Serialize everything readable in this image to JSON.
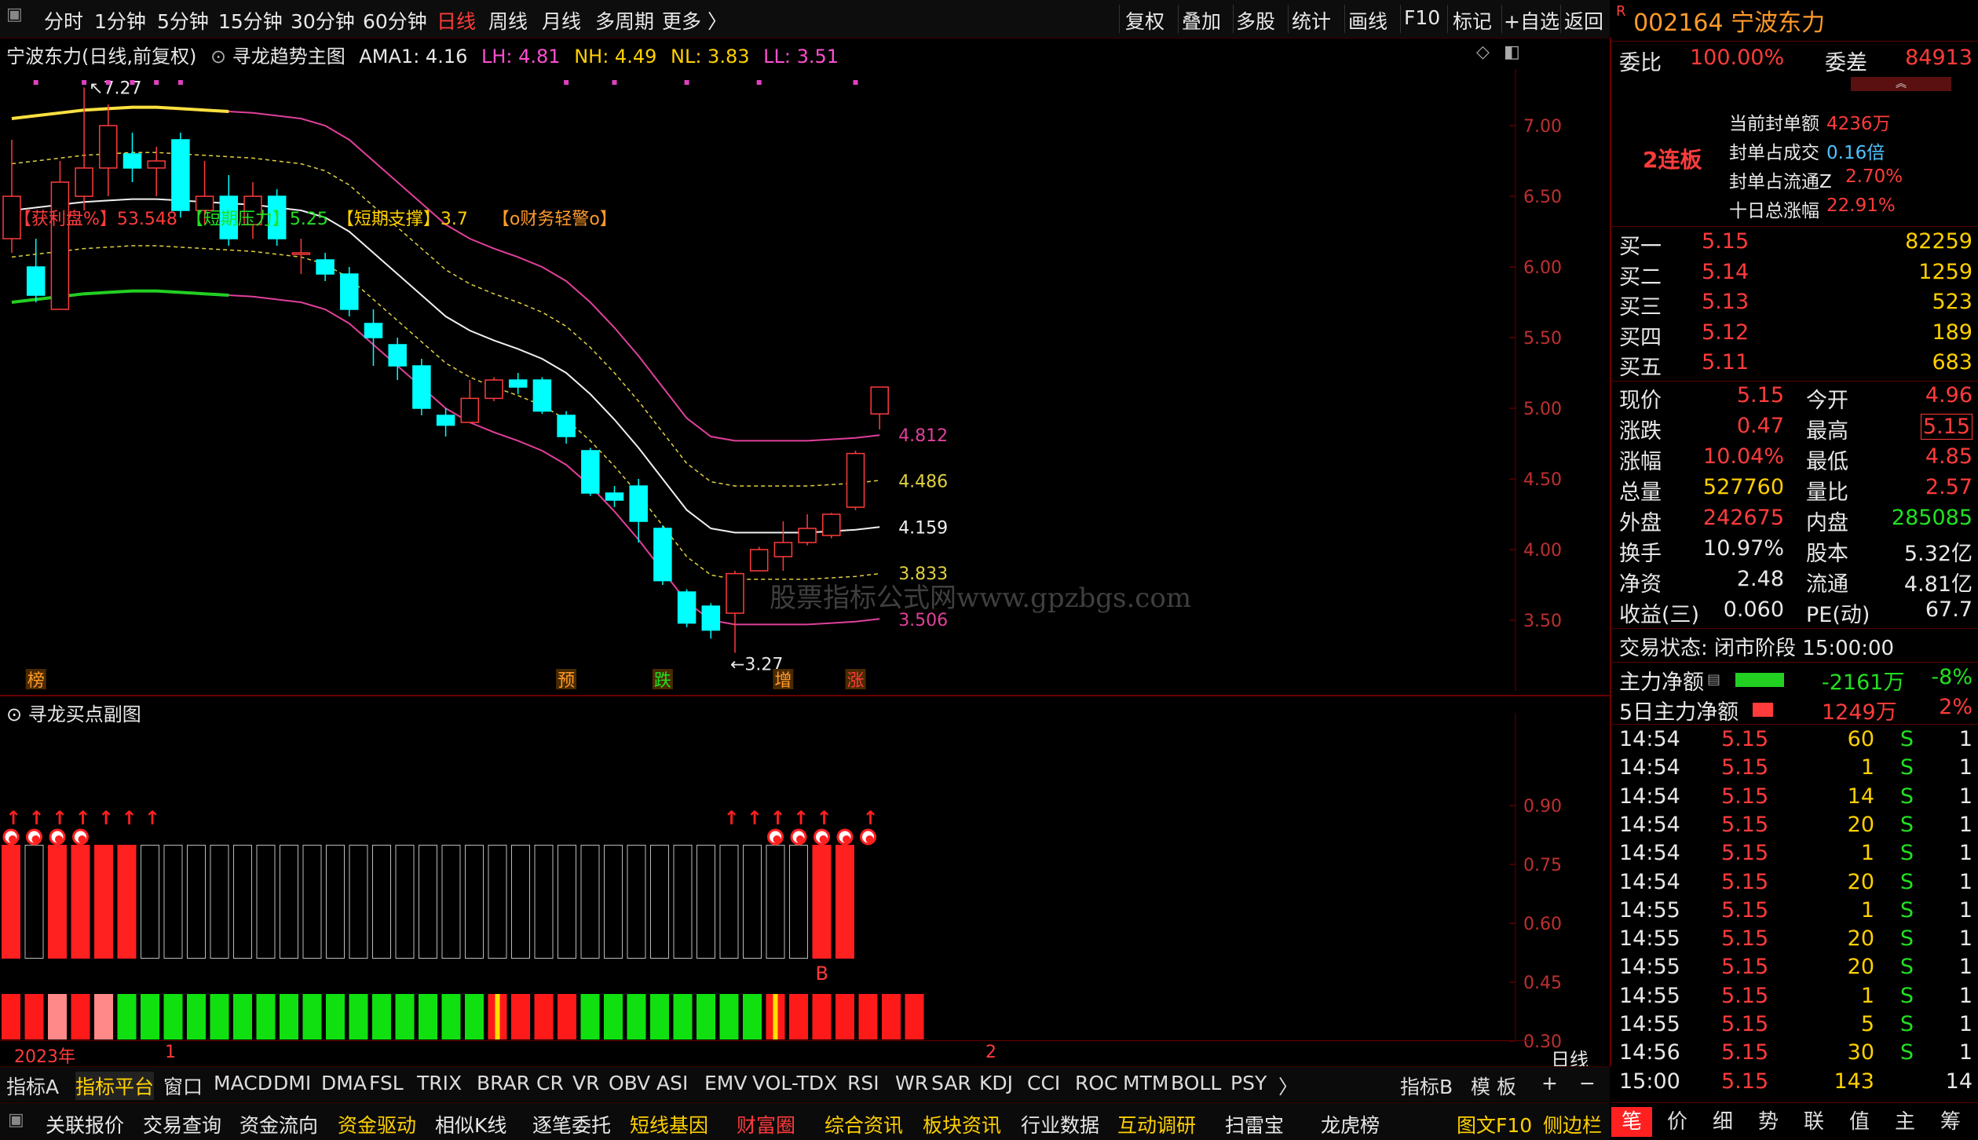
{
  "toolbar": {
    "periods": [
      "分时",
      "1分钟",
      "5分钟",
      "15分钟",
      "30分钟",
      "60分钟",
      "日线",
      "周线",
      "月线",
      "多周期",
      "更多 〉"
    ],
    "active_period": "日线",
    "right_buttons": [
      "复权",
      "叠加",
      "多股",
      "统计",
      "画线",
      "F10",
      "标记",
      "+自选",
      "返回"
    ]
  },
  "chart_header": {
    "stock": "宁波东力(日线,前复权)",
    "indicator": "寻龙趋势主图",
    "ama1": "AMA1: 4.16",
    "lh": "LH: 4.81",
    "nh": "NH: 4.49",
    "nl": "NL: 3.83",
    "ll": "LL: 3.51"
  },
  "main_chart": {
    "price_axis": [
      "7.00",
      "6.50",
      "6.00",
      "5.50",
      "5.00",
      "4.50",
      "4.00",
      "3.50"
    ],
    "band_labels": [
      "4.812",
      "4.486",
      "4.159",
      "3.833",
      "3.506"
    ],
    "high_marker": "7.27",
    "low_marker": "3.27",
    "watermark": "股票指标公式网www.gpzbgs.com",
    "annotations": [
      "【获利盘%】53.548",
      "【短期压力】5.25",
      "【短期支撑】3.7",
      "【o财务轻警o】"
    ],
    "signal_tags": [
      "榜",
      "预",
      "跌",
      "增",
      "涨"
    ]
  },
  "chart_data": {
    "type": "candlestick",
    "period": "日线",
    "ylim": [
      3.0,
      7.4
    ],
    "candles": [
      {
        "o": 6.2,
        "c": 6.5,
        "h": 6.9,
        "l": 6.1
      },
      {
        "o": 6.0,
        "c": 5.8,
        "h": 6.2,
        "l": 5.75
      },
      {
        "o": 5.7,
        "c": 6.6,
        "h": 6.75,
        "l": 5.7
      },
      {
        "o": 6.5,
        "c": 6.7,
        "h": 7.27,
        "l": 6.4
      },
      {
        "o": 6.7,
        "c": 7.0,
        "h": 7.15,
        "l": 6.5
      },
      {
        "o": 6.8,
        "c": 6.7,
        "h": 6.95,
        "l": 6.6
      },
      {
        "o": 6.7,
        "c": 6.75,
        "h": 6.85,
        "l": 6.5
      },
      {
        "o": 6.9,
        "c": 6.4,
        "h": 6.95,
        "l": 6.35
      },
      {
        "o": 6.4,
        "c": 6.5,
        "h": 6.75,
        "l": 6.3
      },
      {
        "o": 6.5,
        "c": 6.2,
        "h": 6.65,
        "l": 6.15
      },
      {
        "o": 6.3,
        "c": 6.5,
        "h": 6.6,
        "l": 6.2
      },
      {
        "o": 6.5,
        "c": 6.2,
        "h": 6.55,
        "l": 6.15
      },
      {
        "o": 6.1,
        "c": 6.1,
        "h": 6.2,
        "l": 5.95
      },
      {
        "o": 6.05,
        "c": 5.95,
        "h": 6.1,
        "l": 5.9
      },
      {
        "o": 5.95,
        "c": 5.7,
        "h": 6.0,
        "l": 5.65
      },
      {
        "o": 5.6,
        "c": 5.5,
        "h": 5.7,
        "l": 5.3
      },
      {
        "o": 5.45,
        "c": 5.3,
        "h": 5.5,
        "l": 5.2
      },
      {
        "o": 5.3,
        "c": 5.0,
        "h": 5.35,
        "l": 4.95
      },
      {
        "o": 4.95,
        "c": 4.88,
        "h": 5.0,
        "l": 4.8
      },
      {
        "o": 4.9,
        "c": 5.07,
        "h": 5.2,
        "l": 4.9
      },
      {
        "o": 5.07,
        "c": 5.2,
        "h": 5.22,
        "l": 5.05
      },
      {
        "o": 5.2,
        "c": 5.15,
        "h": 5.25,
        "l": 5.1
      },
      {
        "o": 5.2,
        "c": 4.98,
        "h": 5.22,
        "l": 4.96
      },
      {
        "o": 4.95,
        "c": 4.8,
        "h": 4.98,
        "l": 4.75
      },
      {
        "o": 4.7,
        "c": 4.4,
        "h": 4.72,
        "l": 4.38
      },
      {
        "o": 4.4,
        "c": 4.35,
        "h": 4.45,
        "l": 4.3
      },
      {
        "o": 4.45,
        "c": 4.2,
        "h": 4.5,
        "l": 4.05
      },
      {
        "o": 4.15,
        "c": 3.78,
        "h": 4.17,
        "l": 3.75
      },
      {
        "o": 3.7,
        "c": 3.48,
        "h": 3.72,
        "l": 3.45
      },
      {
        "o": 3.6,
        "c": 3.43,
        "h": 3.62,
        "l": 3.37
      },
      {
        "o": 3.55,
        "c": 3.83,
        "h": 3.85,
        "l": 3.27
      },
      {
        "o": 3.85,
        "c": 4.0,
        "h": 4.02,
        "l": 3.85
      },
      {
        "o": 3.95,
        "c": 4.05,
        "h": 4.2,
        "l": 3.85
      },
      {
        "o": 4.05,
        "c": 4.15,
        "h": 4.25,
        "l": 4.03
      },
      {
        "o": 4.1,
        "c": 4.25,
        "h": 4.26,
        "l": 4.08
      },
      {
        "o": 4.3,
        "c": 4.68,
        "h": 4.7,
        "l": 4.28
      },
      {
        "o": 4.96,
        "c": 5.15,
        "h": 5.15,
        "l": 4.85
      }
    ],
    "bands": {
      "LH": 4.812,
      "NH": 4.486,
      "AMA1": 4.159,
      "NL": 3.833,
      "LL": 3.506
    }
  },
  "sub_chart": {
    "title": "寻龙买点副图",
    "axis": [
      "0.90",
      "0.75",
      "0.60",
      "0.45",
      "0.30"
    ],
    "b_label": "B",
    "top_bars": [
      "r",
      "o",
      "r",
      "r",
      "r",
      "r",
      "o",
      "o",
      "o",
      "o",
      "o",
      "o",
      "o",
      "o",
      "o",
      "o",
      "o",
      "o",
      "o",
      "o",
      "o",
      "o",
      "o",
      "o",
      "o",
      "o",
      "o",
      "o",
      "o",
      "o",
      "o",
      "o",
      "o",
      "o",
      "o",
      "r",
      "r"
    ],
    "bottom_bars": [
      "r",
      "r",
      "p",
      "r",
      "p",
      "g",
      "g",
      "g",
      "g",
      "g",
      "g",
      "g",
      "g",
      "g",
      "g",
      "g",
      "g",
      "g",
      "g",
      "g",
      "g",
      "y",
      "r",
      "r",
      "r",
      "g",
      "g",
      "g",
      "g",
      "g",
      "g",
      "g",
      "g",
      "y",
      "r",
      "r",
      "r",
      "r",
      "r",
      "r"
    ],
    "arrows_at": [
      0,
      1,
      2,
      3,
      4,
      5,
      6,
      31,
      32,
      33,
      34,
      35,
      37
    ],
    "balls_at": [
      0,
      1,
      2,
      3,
      33,
      34,
      35,
      36,
      37
    ],
    "date_labels": [
      "2023年",
      "1",
      "2"
    ],
    "period_label": "日线"
  },
  "indicator_tabs": [
    "指标A",
    "指标平台",
    "窗口",
    "MACD",
    "DMI",
    "DMA",
    "FSL",
    "TRIX",
    "BRAR",
    "CR",
    "VR",
    "OBV",
    "ASI",
    "EMV",
    "VOL-TDX",
    "RSI",
    "WR",
    "SAR",
    "KDJ",
    "CCI",
    "ROC",
    "MTM",
    "BOLL",
    "PSY",
    "〉"
  ],
  "indicator_tabs_right": [
    "指标B",
    "模 板",
    "+",
    "−"
  ],
  "function_bar": [
    "关联报价",
    "交易查询",
    "资金流向",
    "资金驱动",
    "相似K线",
    "逐笔委托",
    "短线基因",
    "财富圈",
    "综合资讯",
    "板块资讯",
    "行业数据",
    "互动调研",
    "扫雷宝",
    "龙虎榜",
    "图文F10",
    "侧边栏"
  ],
  "quote": {
    "code": "002164",
    "name": "宁波东力",
    "wb_label": "委比",
    "wb_value": "100.00%",
    "wc_label": "委差",
    "wc_value": "84913",
    "streak": "2连板",
    "seal": [
      {
        "label": "当前封单额",
        "value": "4236万"
      },
      {
        "label": "封单占成交",
        "value": "0.16倍"
      },
      {
        "label": "封单占流通Z",
        "value": "2.70%"
      },
      {
        "label": "十日总涨幅",
        "value": "22.91%"
      }
    ],
    "bids": [
      {
        "label": "买一",
        "price": "5.15",
        "vol": "82259"
      },
      {
        "label": "买二",
        "price": "5.14",
        "vol": "1259"
      },
      {
        "label": "买三",
        "price": "5.13",
        "vol": "523"
      },
      {
        "label": "买四",
        "price": "5.12",
        "vol": "189"
      },
      {
        "label": "买五",
        "price": "5.11",
        "vol": "683"
      }
    ],
    "stats": [
      {
        "l1": "现价",
        "v1": "5.15",
        "l2": "今开",
        "v2": "4.96"
      },
      {
        "l1": "涨跌",
        "v1": "0.47",
        "l2": "最高",
        "v2": "5.15"
      },
      {
        "l1": "涨幅",
        "v1": "10.04%",
        "l2": "最低",
        "v2": "4.85"
      },
      {
        "l1": "总量",
        "v1": "527760",
        "l2": "量比",
        "v2": "2.57"
      },
      {
        "l1": "外盘",
        "v1": "242675",
        "l2": "内盘",
        "v2": "285085"
      },
      {
        "l1": "换手",
        "v1": "10.97%",
        "l2": "股本",
        "v2": "5.32亿"
      },
      {
        "l1": "净资",
        "v1": "2.48",
        "l2": "流通",
        "v2": "4.81亿"
      },
      {
        "l1": "收益(三)",
        "v1": "0.060",
        "l2": "PE(动)",
        "v2": "67.7"
      }
    ],
    "status": "交易状态: 闭市阶段 15:00:00",
    "main_flow_label": "主力净额",
    "main_flow_value": "-2161万",
    "main_flow_pct": "-8%",
    "main5_label": "5日主力净额",
    "main5_value": "1249万",
    "main5_pct": "2%",
    "ticks": [
      {
        "t": "14:54",
        "p": "5.15",
        "v": "60",
        "s": "S",
        "n": "1"
      },
      {
        "t": "14:54",
        "p": "5.15",
        "v": "1",
        "s": "S",
        "n": "1"
      },
      {
        "t": "14:54",
        "p": "5.15",
        "v": "14",
        "s": "S",
        "n": "1"
      },
      {
        "t": "14:54",
        "p": "5.15",
        "v": "20",
        "s": "S",
        "n": "1"
      },
      {
        "t": "14:54",
        "p": "5.15",
        "v": "1",
        "s": "S",
        "n": "1"
      },
      {
        "t": "14:54",
        "p": "5.15",
        "v": "20",
        "s": "S",
        "n": "1"
      },
      {
        "t": "14:55",
        "p": "5.15",
        "v": "1",
        "s": "S",
        "n": "1"
      },
      {
        "t": "14:55",
        "p": "5.15",
        "v": "20",
        "s": "S",
        "n": "1"
      },
      {
        "t": "14:55",
        "p": "5.15",
        "v": "20",
        "s": "S",
        "n": "1"
      },
      {
        "t": "14:55",
        "p": "5.15",
        "v": "1",
        "s": "S",
        "n": "1"
      },
      {
        "t": "14:55",
        "p": "5.15",
        "v": "5",
        "s": "S",
        "n": "1"
      },
      {
        "t": "14:56",
        "p": "5.15",
        "v": "30",
        "s": "S",
        "n": "1"
      },
      {
        "t": "15:00",
        "p": "5.15",
        "v": "143",
        "s": "",
        "n": "14"
      }
    ],
    "bottom_tabs": [
      "笔",
      "价",
      "细",
      "势",
      "联",
      "值",
      "主",
      "筹"
    ]
  }
}
